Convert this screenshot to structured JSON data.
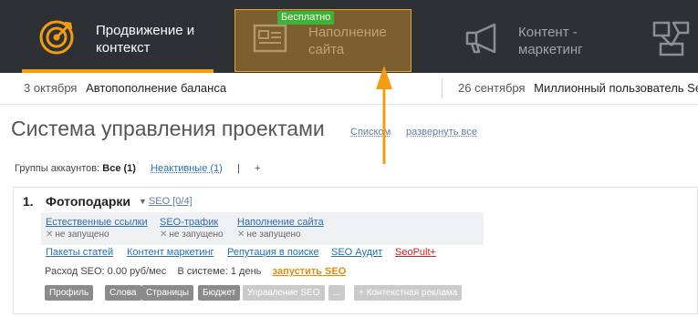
{
  "nav": {
    "items": [
      {
        "label_line1": "Продвижение и",
        "label_line2": "контекст",
        "icon": "target-icon",
        "active": true
      },
      {
        "label_line1": "Наполнение",
        "label_line2": "сайта",
        "icon": "document-icon",
        "badge": "Бесплатно"
      },
      {
        "label_line1": "Контент -",
        "label_line2": "маркетинг",
        "icon": "megaphone-icon"
      },
      {
        "icon": "plant-icon"
      }
    ]
  },
  "ticker": [
    {
      "date": "3 октября",
      "title": "Автопополнение баланса"
    },
    {
      "date": "26 сентября",
      "title": "Миллионный пользователь Se"
    }
  ],
  "page": {
    "title": "Система управления проектами",
    "view_list": "Списком",
    "expand_all": "развернуть все"
  },
  "groups": {
    "label": "Группы аккаунтов:",
    "all": "Все (1)",
    "inactive": "Неактивные (1)",
    "sep": "|",
    "add": "+"
  },
  "project": {
    "num": "1.",
    "name": "Фотоподарки",
    "seo_link": "SEO [0/4]",
    "services": [
      {
        "name": "Естественные ссылки",
        "status": "не запущено"
      },
      {
        "name": "SEO-трафик",
        "status": "не запущено"
      },
      {
        "name": "Наполнение сайта",
        "status": "не запущено"
      }
    ],
    "links": [
      "Пакеты статей",
      "Контент маркетинг",
      "Репутация в поиске",
      "SEO Аудит"
    ],
    "seopult": "SeoPult+",
    "expense": "Расход SEO: 0.00 руб/мес",
    "in_system": "В системе: 1 день",
    "launch": "запустить SEO",
    "tags": [
      "Профиль",
      "Слова",
      "Страницы",
      "Бюджет",
      "Управление SEO",
      "...",
      "+ Контекстная реклама"
    ]
  },
  "colors": {
    "nav_bg": "#2d3035",
    "accent": "#f39c12",
    "badge": "#3db338",
    "link": "#2a6fb0",
    "red": "#d42020"
  }
}
